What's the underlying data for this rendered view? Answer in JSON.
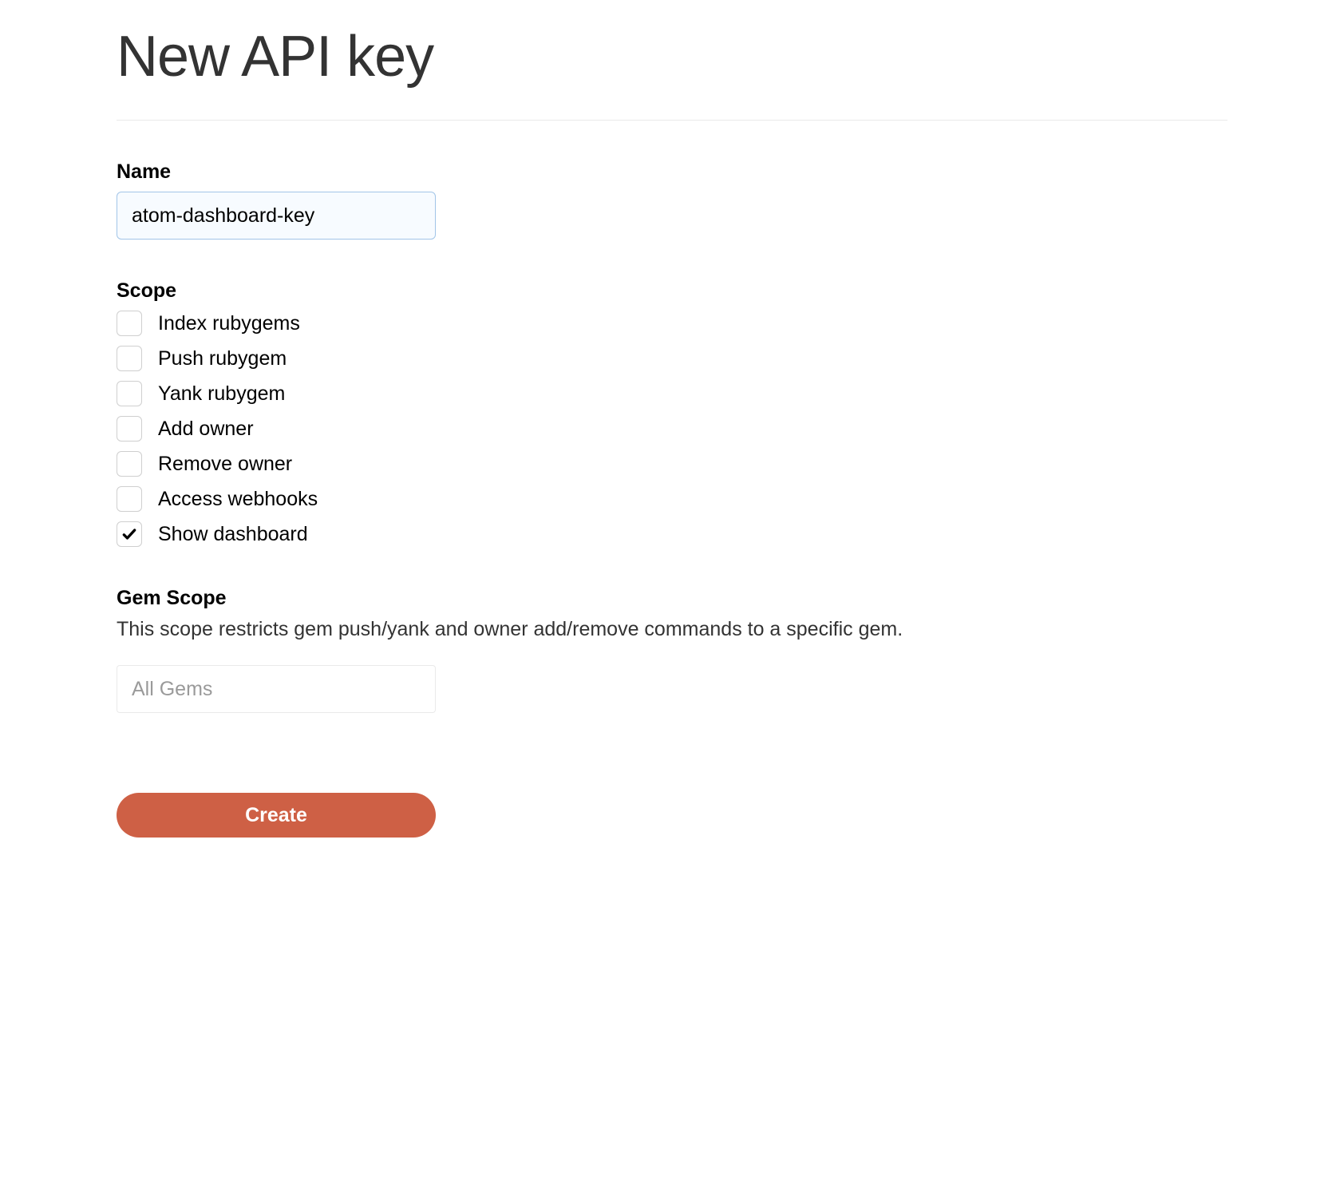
{
  "title": "New API key",
  "name": {
    "label": "Name",
    "value": "atom-dashboard-key"
  },
  "scope": {
    "label": "Scope",
    "items": [
      {
        "id": "index-rubygems",
        "label": "Index rubygems",
        "checked": false
      },
      {
        "id": "push-rubygem",
        "label": "Push rubygem",
        "checked": false
      },
      {
        "id": "yank-rubygem",
        "label": "Yank rubygem",
        "checked": false
      },
      {
        "id": "add-owner",
        "label": "Add owner",
        "checked": false
      },
      {
        "id": "remove-owner",
        "label": "Remove owner",
        "checked": false
      },
      {
        "id": "access-webhooks",
        "label": "Access webhooks",
        "checked": false
      },
      {
        "id": "show-dashboard",
        "label": "Show dashboard",
        "checked": true
      }
    ]
  },
  "gemScope": {
    "label": "Gem Scope",
    "description": "This scope restricts gem push/yank and owner add/remove commands to a specific gem.",
    "selected": "All Gems"
  },
  "actions": {
    "create": "Create"
  }
}
